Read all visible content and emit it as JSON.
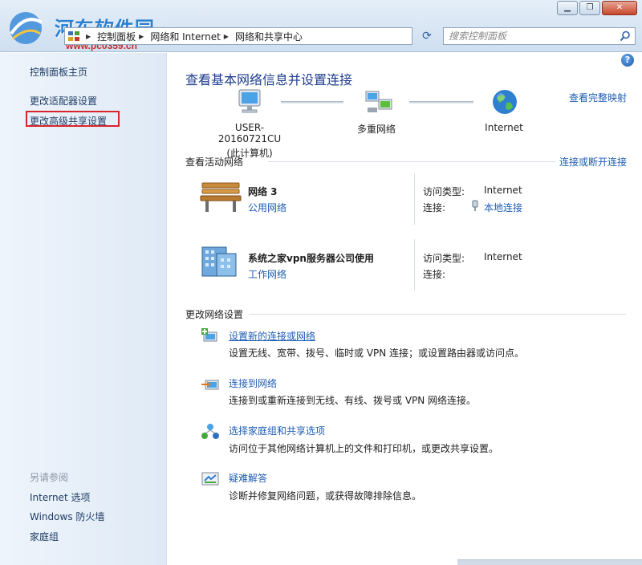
{
  "watermark": {
    "title": "河东软件园",
    "url": "www.pc0359.cn"
  },
  "window": {
    "minimize": "▁",
    "maximize": "❐",
    "close": "✕"
  },
  "address": {
    "crumbs": [
      "控制面板",
      "网络和 Internet",
      "网络和共享中心"
    ]
  },
  "search": {
    "placeholder": "搜索控制面板"
  },
  "sidebar": {
    "home": "控制面板主页",
    "items": [
      "更改适配器设置",
      "更改高级共享设置"
    ],
    "see_also_label": "另请参阅",
    "see_also": [
      "Internet 选项",
      "Windows 防火墙",
      "家庭组"
    ]
  },
  "main": {
    "title": "查看基本网络信息并设置连接",
    "full_map": "查看完整映射",
    "nodes": [
      {
        "name": "USER-20160721CU",
        "sub": "(此计算机)"
      },
      {
        "name": "多重网络",
        "sub": ""
      },
      {
        "name": "Internet",
        "sub": ""
      }
    ],
    "active_label": "查看活动网络",
    "connect_link": "连接或断开连接",
    "networks": [
      {
        "name": "网络  3",
        "type": "公用网络",
        "access_label": "访问类型:",
        "access_value": "Internet",
        "conn_label": "连接:",
        "conn_value": "本地连接"
      },
      {
        "name": "系统之家vpn服务器公司使用",
        "type": "工作网络",
        "access_label": "访问类型:",
        "access_value": "Internet",
        "conn_label": "连接:",
        "conn_value": ""
      }
    ],
    "change_label": "更改网络设置",
    "tasks": [
      {
        "title": "设置新的连接或网络",
        "desc": "设置无线、宽带、拨号、临时或 VPN 连接；或设置路由器或访问点。"
      },
      {
        "title": "连接到网络",
        "desc": "连接到或重新连接到无线、有线、拨号或 VPN 网络连接。"
      },
      {
        "title": "选择家庭组和共享选项",
        "desc": "访问位于其他网络计算机上的文件和打印机，或更改共享设置。"
      },
      {
        "title": "疑难解答",
        "desc": "诊断并修复网络问题，或获得故障排除信息。"
      }
    ]
  },
  "colors": {
    "link": "#1e5cb3",
    "title": "#1e3c8c",
    "highlight": "#d9252a"
  }
}
